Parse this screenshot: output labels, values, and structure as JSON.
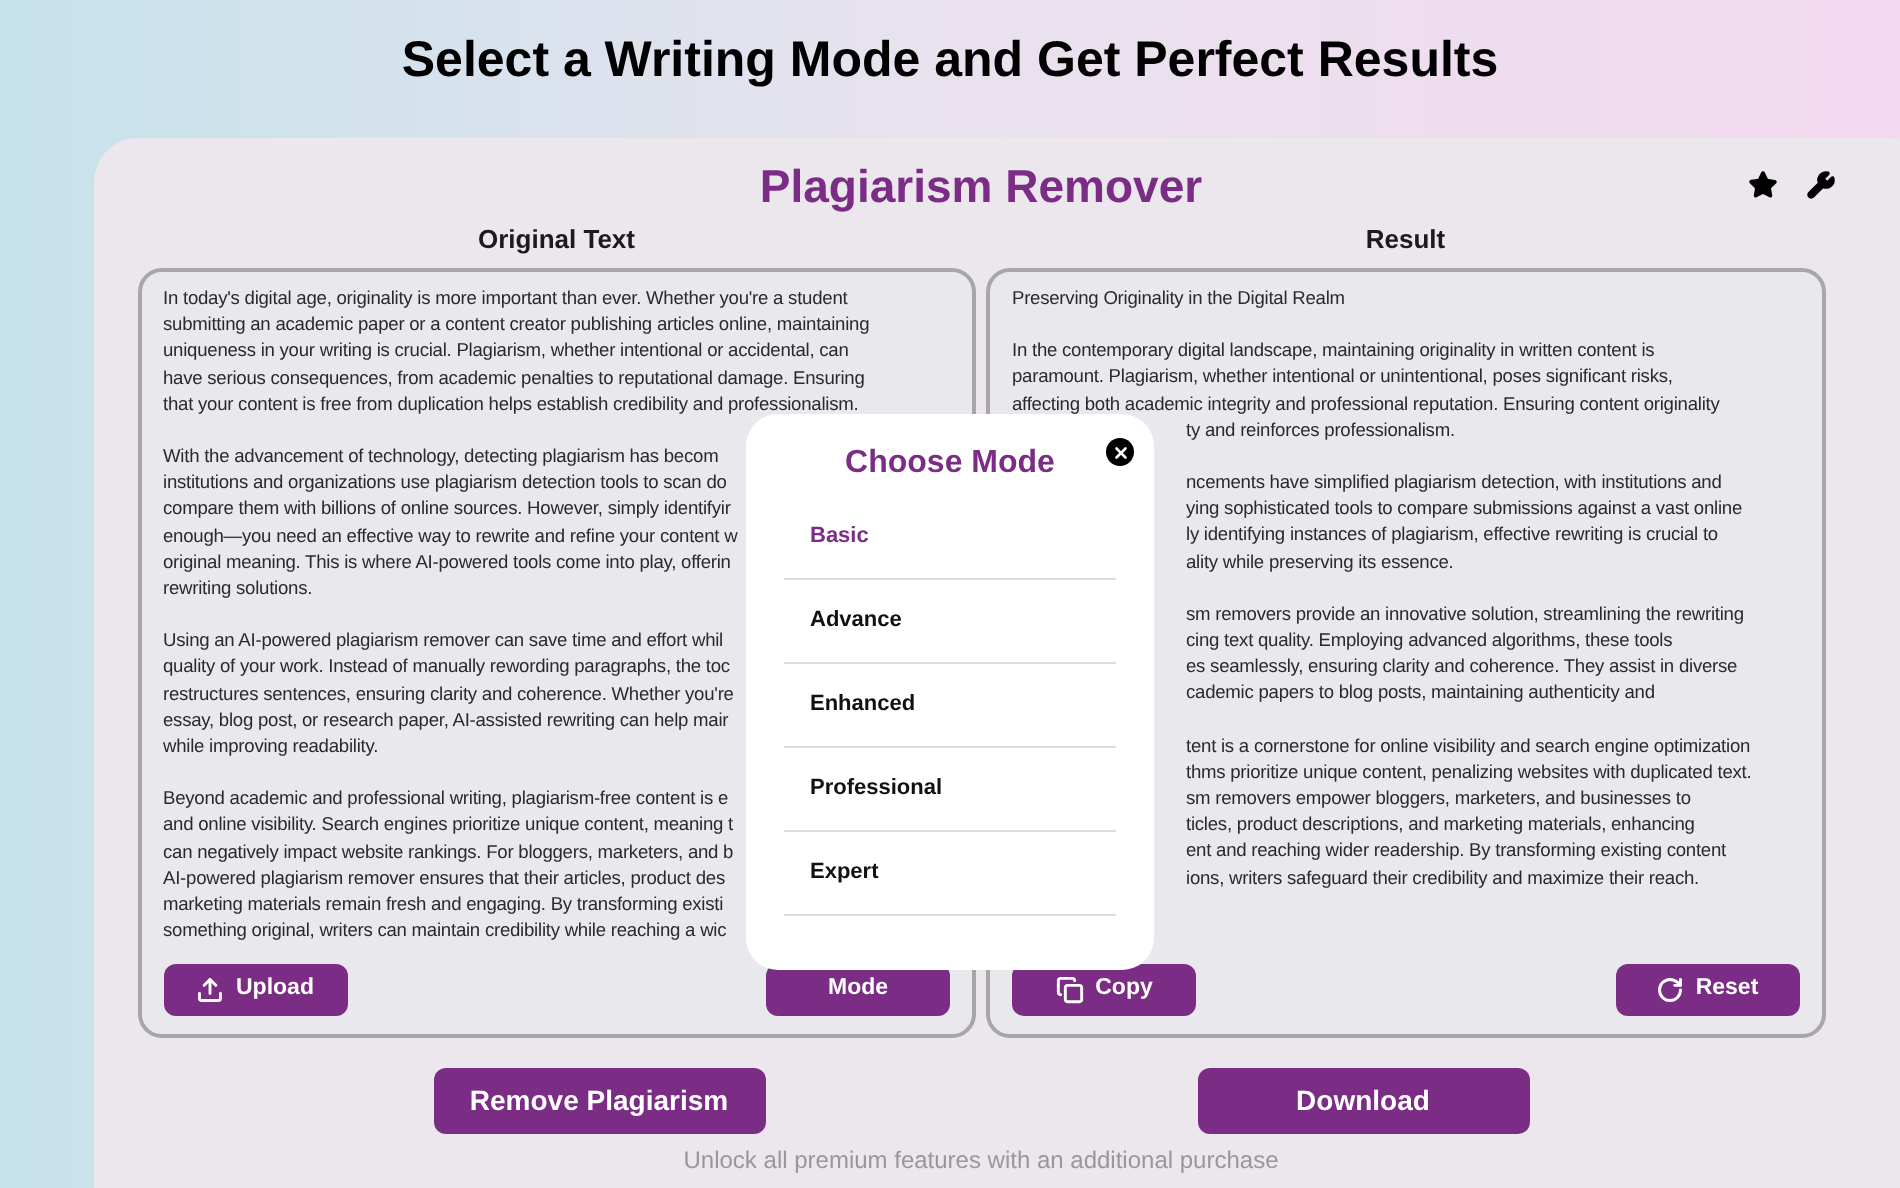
{
  "headline": "Select a Writing Mode and Get Perfect Results",
  "app_title": "Plagiarism Remover",
  "original": {
    "label": "Original Text",
    "paragraphs": [
      {
        "lines": [
          {
            "kind": "full",
            "text": "In today's digital age, originality is more important than ever. Whether you're a student"
          },
          {
            "kind": "full",
            "text": "submitting an academic paper or a content creator publishing articles online, maintaining"
          },
          {
            "kind": "full",
            "text": "uniqueness in your writing is crucial. Plagiarism, whether intentional or accidental, can"
          },
          {
            "kind": "full",
            "text": "have serious consequences, from academic penalties to reputational damage. Ensuring"
          },
          {
            "kind": "full",
            "text": "that your content is free from duplication helps establish credibility and professionalism."
          }
        ]
      },
      {
        "lines": [
          {
            "kind": "full",
            "text": "With the advancement of technology, detecting plagiarism has becom"
          },
          {
            "kind": "full",
            "text": "institutions and organizations use plagiarism detection tools to scan do"
          },
          {
            "kind": "full",
            "text": "compare them with billions of online sources. However, simply identifyir"
          },
          {
            "kind": "full",
            "text": "enough—you need an effective way to rewrite and refine your content w"
          },
          {
            "kind": "full",
            "text": "original meaning. This is where AI-powered tools come into play, offerin"
          },
          {
            "kind": "full",
            "text": "rewriting solutions."
          }
        ]
      },
      {
        "lines": [
          {
            "kind": "full",
            "text": "Using an AI-powered plagiarism remover can save time and effort whil"
          },
          {
            "kind": "full",
            "text": "quality of your work. Instead of manually rewording paragraphs, the toc"
          },
          {
            "kind": "full",
            "text": "restructures sentences, ensuring clarity and coherence. Whether you're"
          },
          {
            "kind": "full",
            "text": "essay, blog post, or research paper, AI-assisted rewriting can help mair"
          },
          {
            "kind": "full",
            "text": "while improving readability."
          }
        ]
      },
      {
        "lines": [
          {
            "kind": "full",
            "text": "Beyond academic and professional writing, plagiarism-free content is e"
          },
          {
            "kind": "full",
            "text": "and online visibility. Search engines prioritize unique content, meaning t"
          },
          {
            "kind": "full",
            "text": "can negatively impact website rankings. For bloggers, marketers, and b"
          },
          {
            "kind": "full",
            "text": "AI-powered plagiarism remover ensures that their articles, product des"
          },
          {
            "kind": "full",
            "text": "marketing materials remain fresh and engaging. By transforming existi"
          },
          {
            "kind": "full",
            "text": "something original, writers can maintain credibility while reaching a wic"
          }
        ]
      }
    ],
    "buttons": [
      {
        "kind": "upload",
        "label": "Upload"
      },
      {
        "kind": "mode",
        "label": "Mode"
      }
    ]
  },
  "result": {
    "label": "Result",
    "paragraphs": [
      {
        "lines": [
          {
            "kind": "full",
            "text": "Preserving Originality in the Digital Realm"
          }
        ]
      },
      {
        "lines": [
          {
            "kind": "full",
            "text": "In the contemporary digital landscape, maintaining originality in written content is"
          },
          {
            "kind": "full",
            "text": "paramount. Plagiarism, whether intentional or unintentional, poses significant risks,"
          },
          {
            "kind": "full",
            "text": "affecting both academic integrity and professional reputation. Ensuring content originality"
          },
          {
            "kind": "partial",
            "text": "ty and reinforces professionalism."
          }
        ]
      },
      {
        "lines": [
          {
            "kind": "partial",
            "text": "ncements have simplified plagiarism detection, with institutions and"
          },
          {
            "kind": "partial",
            "text": "ying sophisticated tools to compare submissions against a vast online"
          },
          {
            "kind": "partial",
            "text": "ly identifying instances of plagiarism, effective rewriting is crucial to"
          },
          {
            "kind": "partial",
            "text": "ality while preserving its essence."
          }
        ]
      },
      {
        "lines": [
          {
            "kind": "partial",
            "text": "sm removers provide an innovative solution, streamlining the rewriting"
          },
          {
            "kind": "partial",
            "text": "cing text quality. Employing advanced algorithms, these tools"
          },
          {
            "kind": "partial",
            "text": "es seamlessly, ensuring clarity and coherence. They assist in diverse"
          },
          {
            "kind": "partial",
            "text": "cademic papers to blog posts, maintaining authenticity and"
          }
        ]
      },
      {
        "lines": [
          {
            "kind": "partial",
            "text": "tent is a cornerstone for online visibility and search engine optimization"
          },
          {
            "kind": "partial",
            "text": "thms prioritize unique content, penalizing websites with duplicated text."
          },
          {
            "kind": "partial",
            "text": "sm removers empower bloggers, marketers, and businesses to"
          },
          {
            "kind": "partial",
            "text": "ticles, product descriptions, and marketing materials, enhancing"
          },
          {
            "kind": "partial",
            "text": "ent and reaching wider readership. By transforming existing content"
          },
          {
            "kind": "partial",
            "text": "ions, writers safeguard their credibility and maximize their reach."
          }
        ]
      }
    ],
    "buttons": [
      {
        "kind": "copy",
        "label": "Copy"
      },
      {
        "kind": "reset",
        "label": "Reset"
      }
    ]
  },
  "actions": [
    "Remove Plagiarism",
    "Download"
  ],
  "footer": "Unlock all premium features with an additional purchase",
  "modal": {
    "title": "Choose Mode",
    "options": [
      {
        "label": "Basic",
        "selected": true
      },
      {
        "label": "Advance",
        "selected": false
      },
      {
        "label": "Enhanced",
        "selected": false
      },
      {
        "label": "Professional",
        "selected": false
      },
      {
        "label": "Expert",
        "selected": false
      }
    ]
  }
}
